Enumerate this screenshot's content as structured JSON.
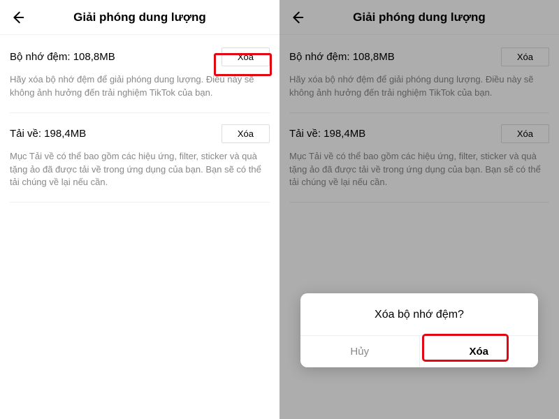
{
  "header": {
    "title": "Giải phóng dung lượng"
  },
  "cache": {
    "label": "Bộ nhớ đệm: 108,8MB",
    "button": "Xóa",
    "desc": "Hãy xóa bộ nhớ đệm để giải phóng dung lượng. Điều này sẽ không ảnh hưởng đến trải nghiệm TikTok của bạn."
  },
  "downloads": {
    "label": "Tải về: 198,4MB",
    "button": "Xóa",
    "desc": "Mục Tải về có thể bao gồm các hiệu ứng, filter, sticker và quà tặng ảo đã được tải về trong ứng dụng của bạn. Bạn sẽ có thể tải chúng về lại nếu cần."
  },
  "dialog": {
    "title": "Xóa bộ nhớ đệm?",
    "cancel": "Hủy",
    "confirm": "Xóa"
  }
}
